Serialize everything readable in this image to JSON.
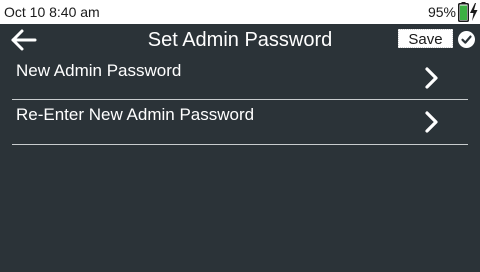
{
  "status_bar": {
    "datetime": "Oct 10 8:40 am",
    "battery_percent": "95%",
    "battery_icon": "battery-charging-icon",
    "battery_color": "#3cb043"
  },
  "header": {
    "back_icon": "back-arrow-icon",
    "title": "Set Admin Password",
    "save_label": "Save",
    "save_icon": "check-circle-icon"
  },
  "menu": {
    "items": [
      {
        "label": "New Admin Password",
        "icon": "chevron-right-icon"
      },
      {
        "label": "Re-Enter New Admin Password",
        "icon": "chevron-right-icon"
      }
    ]
  },
  "colors": {
    "background": "#2b3338",
    "text": "#ffffff",
    "status_bar": "#ffffff"
  }
}
